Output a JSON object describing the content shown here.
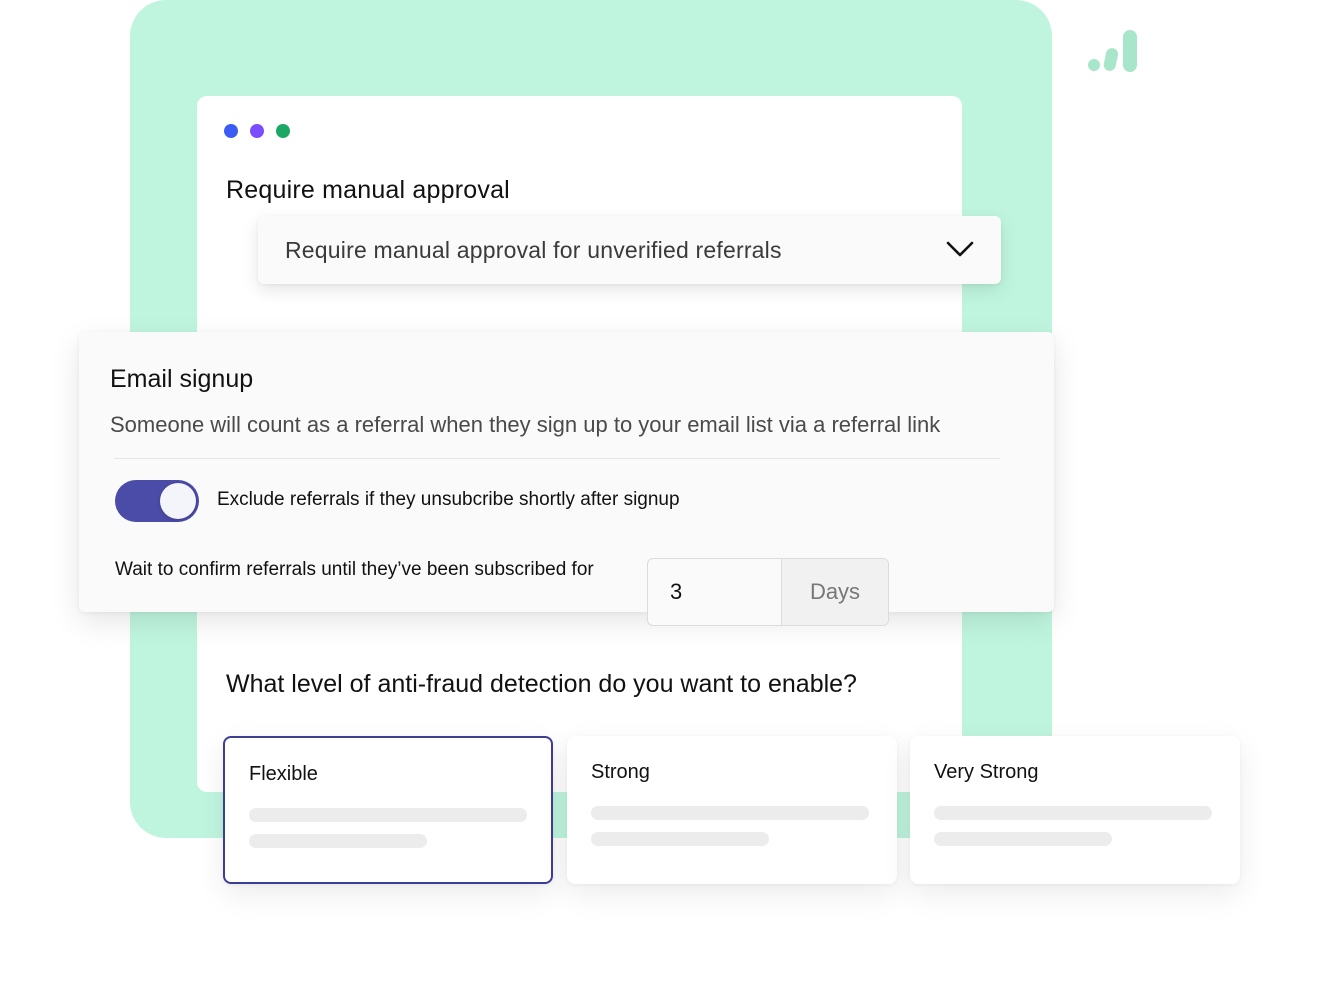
{
  "window": {
    "dots": [
      {
        "name": "dot-blue",
        "color": "#3b5bf5"
      },
      {
        "name": "dot-purple",
        "color": "#7c4dff"
      },
      {
        "name": "dot-green",
        "color": "#1aa864"
      }
    ]
  },
  "approval": {
    "title": "Require manual approval",
    "select_value": "Require manual approval for unverified referrals",
    "chevron_icon": "chevron-down-icon"
  },
  "email_signup": {
    "title": "Email signup",
    "description": "Someone will count as a referral when they sign up to your email list via a referral link",
    "toggle_label": "Exclude referrals if they unsubcribe shortly after signup",
    "toggle_on": true,
    "wait_label": "Wait to confirm referrals until they’ve been subscribed for",
    "wait_value": "3",
    "wait_unit": "Days"
  },
  "fraud": {
    "question": "What level of anti-fraud detection do you want to enable?",
    "levels": [
      {
        "label": "Flexible",
        "selected": true
      },
      {
        "label": "Strong",
        "selected": false
      },
      {
        "label": "Very Strong",
        "selected": false
      }
    ]
  },
  "colors": {
    "background_mint": "#bff5df",
    "accent": "#4b4ba8",
    "selected_border": "#3d3d94"
  },
  "icons": {
    "brand_logo": "signal-bars-logo-icon"
  }
}
